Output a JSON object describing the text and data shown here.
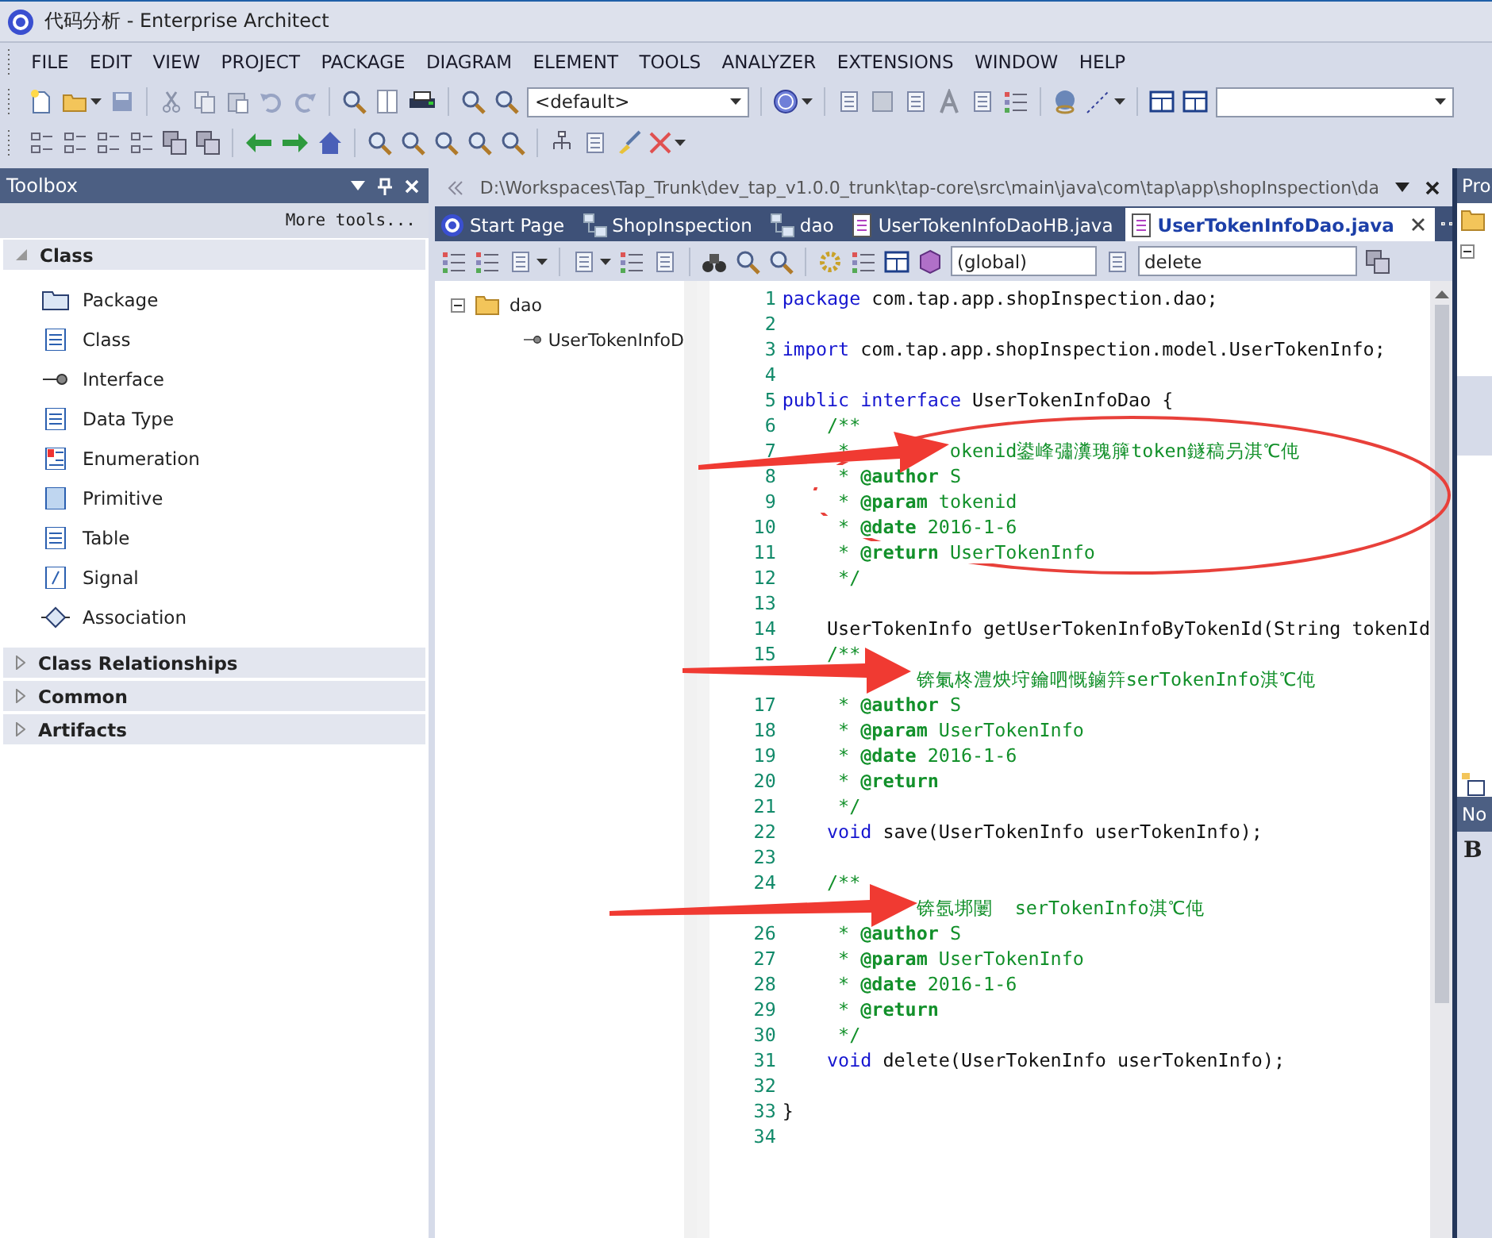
{
  "window": {
    "title": "代码分析 - Enterprise Architect"
  },
  "menu": [
    "FILE",
    "EDIT",
    "VIEW",
    "PROJECT",
    "PACKAGE",
    "DIAGRAM",
    "ELEMENT",
    "TOOLS",
    "ANALYZER",
    "EXTENSIONS",
    "WINDOW",
    "HELP"
  ],
  "toolbar": {
    "profile_combo": "<default>"
  },
  "toolbox": {
    "title": "Toolbox",
    "more_tools": "More tools...",
    "groups": [
      {
        "label": "Class",
        "expanded": true,
        "items": [
          {
            "label": "Package",
            "kind": "package"
          },
          {
            "label": "Class",
            "kind": "class"
          },
          {
            "label": "Interface",
            "kind": "interface"
          },
          {
            "label": "Data Type",
            "kind": "datatype"
          },
          {
            "label": "Enumeration",
            "kind": "enumeration"
          },
          {
            "label": "Primitive",
            "kind": "primitive"
          },
          {
            "label": "Table",
            "kind": "table"
          },
          {
            "label": "Signal",
            "kind": "signal"
          },
          {
            "label": "Association",
            "kind": "association"
          }
        ]
      },
      {
        "label": "Class Relationships",
        "expanded": false
      },
      {
        "label": "Common",
        "expanded": false
      },
      {
        "label": "Artifacts",
        "expanded": false
      }
    ]
  },
  "editor": {
    "path": "D:\\Workspaces\\Tap_Trunk\\dev_tap_v1.0.0_trunk\\tap-core\\src\\main\\java\\com\\tap\\app\\shopInspection\\da",
    "tabs": [
      {
        "label": "Start Page",
        "kind": "start",
        "selected": false
      },
      {
        "label": "ShopInspection",
        "kind": "package",
        "selected": false
      },
      {
        "label": "dao",
        "kind": "package",
        "selected": false
      },
      {
        "label": "UserTokenInfoDaoHB.java",
        "kind": "file",
        "selected": false
      },
      {
        "label": "UserTokenInfoDao.java",
        "kind": "file",
        "selected": true
      }
    ],
    "scope_combo": "(global)",
    "member_combo": "delete",
    "tree": {
      "label": "dao",
      "expanded": true,
      "children": [
        {
          "label": "UserTokenInfoD"
        }
      ]
    },
    "lines": [
      {
        "n": "1",
        "tokens": [
          {
            "kind": "keyword",
            "text": "package"
          },
          {
            "kind": "plain",
            "text": " com.tap.app.shopInspection.dao;"
          }
        ]
      },
      {
        "n": "2"
      },
      {
        "n": "3",
        "tokens": [
          {
            "kind": "keyword",
            "text": "import"
          },
          {
            "kind": "plain",
            "text": " com.tap.app.shopInspection.model.UserTokenInfo;"
          }
        ]
      },
      {
        "n": "4"
      },
      {
        "n": "5",
        "tokens": [
          {
            "kind": "keyword",
            "text": "public"
          },
          {
            "kind": "keyword",
            "text": " interface"
          },
          {
            "kind": "plain",
            "text": " UserTokenInfoDao {"
          }
        ]
      },
      {
        "n": "6",
        "tokens": [
          {
            "kind": "comment",
            "text": "    /**"
          }
        ]
      },
      {
        "n": "7",
        "tokens": [
          {
            "kind": "comment",
            "text": "     *         okenid鍙峰彇瀵瑰簲token鐩稿叧淇℃伅"
          }
        ]
      },
      {
        "n": "8",
        "tokens": [
          {
            "kind": "comment",
            "text": "     * "
          },
          {
            "kind": "tag",
            "text": "@author"
          },
          {
            "kind": "comment",
            "text": " S"
          }
        ]
      },
      {
        "n": "9",
        "tokens": [
          {
            "kind": "comment",
            "text": "     * "
          },
          {
            "kind": "tag",
            "text": "@param"
          },
          {
            "kind": "comment",
            "text": " tokenid"
          }
        ]
      },
      {
        "n": "10",
        "tokens": [
          {
            "kind": "comment",
            "text": "     * "
          },
          {
            "kind": "tag",
            "text": "@date"
          },
          {
            "kind": "comment",
            "text": " 2016-1-6"
          }
        ]
      },
      {
        "n": "11",
        "tokens": [
          {
            "kind": "comment",
            "text": "     * "
          },
          {
            "kind": "tag",
            "text": "@return"
          },
          {
            "kind": "comment",
            "text": " UserTokenInfo"
          }
        ]
      },
      {
        "n": "12",
        "tokens": [
          {
            "kind": "comment",
            "text": "     */"
          }
        ]
      },
      {
        "n": "13"
      },
      {
        "n": "14",
        "tokens": [
          {
            "kind": "plain",
            "text": "    UserTokenInfo getUserTokenInfoByTokenId(String tokenId"
          }
        ]
      },
      {
        "n": "15",
        "tokens": [
          {
            "kind": "comment",
            "text": "    /**"
          }
        ]
      },
      {
        "tokens": [
          {
            "kind": "comment",
            "text": "            锛氭柊澧炴垨鑰呬慨鏀筓serTokenInfo淇℃伅"
          }
        ]
      },
      {
        "n": "17",
        "tokens": [
          {
            "kind": "comment",
            "text": "     * "
          },
          {
            "kind": "tag",
            "text": "@author"
          },
          {
            "kind": "comment",
            "text": " S"
          }
        ]
      },
      {
        "n": "18",
        "tokens": [
          {
            "kind": "comment",
            "text": "     * "
          },
          {
            "kind": "tag",
            "text": "@param"
          },
          {
            "kind": "comment",
            "text": " UserTokenInfo"
          }
        ]
      },
      {
        "n": "19",
        "tokens": [
          {
            "kind": "comment",
            "text": "     * "
          },
          {
            "kind": "tag",
            "text": "@date"
          },
          {
            "kind": "comment",
            "text": " 2016-1-6"
          }
        ]
      },
      {
        "n": "20",
        "tokens": [
          {
            "kind": "comment",
            "text": "     * "
          },
          {
            "kind": "tag",
            "text": "@return"
          }
        ]
      },
      {
        "n": "21",
        "tokens": [
          {
            "kind": "comment",
            "text": "     */"
          }
        ]
      },
      {
        "n": "22",
        "tokens": [
          {
            "kind": "keyword",
            "text": "    void"
          },
          {
            "kind": "plain",
            "text": " save(UserTokenInfo userTokenInfo);"
          }
        ]
      },
      {
        "n": "23"
      },
      {
        "n": "24",
        "tokens": [
          {
            "kind": "comment",
            "text": "    /**"
          }
        ]
      },
      {
        "tokens": [
          {
            "kind": "comment",
            "text": "            锛氬垹闄  serTokenInfo淇℃伅"
          }
        ]
      },
      {
        "n": "26",
        "tokens": [
          {
            "kind": "comment",
            "text": "     * "
          },
          {
            "kind": "tag",
            "text": "@author"
          },
          {
            "kind": "comment",
            "text": " S"
          }
        ]
      },
      {
        "n": "27",
        "tokens": [
          {
            "kind": "comment",
            "text": "     * "
          },
          {
            "kind": "tag",
            "text": "@param"
          },
          {
            "kind": "comment",
            "text": " UserTokenInfo"
          }
        ]
      },
      {
        "n": "28",
        "tokens": [
          {
            "kind": "comment",
            "text": "     * "
          },
          {
            "kind": "tag",
            "text": "@date"
          },
          {
            "kind": "comment",
            "text": " 2016-1-6"
          }
        ]
      },
      {
        "n": "29",
        "tokens": [
          {
            "kind": "comment",
            "text": "     * "
          },
          {
            "kind": "tag",
            "text": "@return"
          }
        ]
      },
      {
        "n": "30",
        "tokens": [
          {
            "kind": "comment",
            "text": "     */"
          }
        ]
      },
      {
        "n": "31",
        "tokens": [
          {
            "kind": "keyword",
            "text": "    void"
          },
          {
            "kind": "plain",
            "text": " delete(UserTokenInfo userTokenInfo);"
          }
        ]
      },
      {
        "n": "32"
      },
      {
        "n": "33",
        "tokens": [
          {
            "kind": "plain",
            "text": "}"
          }
        ]
      },
      {
        "n": "34"
      }
    ]
  },
  "side_panels": [
    {
      "title": "Pro"
    },
    {
      "title": "No",
      "body": "B"
    }
  ]
}
